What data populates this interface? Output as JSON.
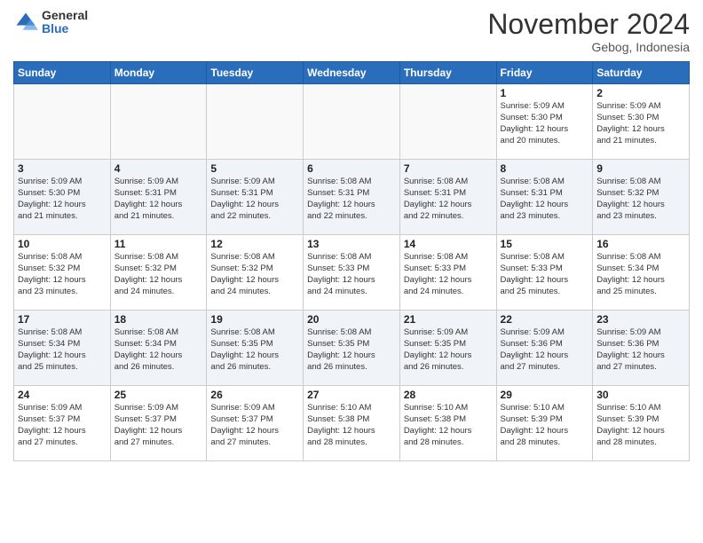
{
  "header": {
    "logo": {
      "general": "General",
      "blue": "Blue"
    },
    "title": "November 2024",
    "location": "Gebog, Indonesia"
  },
  "weekdays": [
    "Sunday",
    "Monday",
    "Tuesday",
    "Wednesday",
    "Thursday",
    "Friday",
    "Saturday"
  ],
  "weeks": [
    [
      {
        "day": "",
        "info": "",
        "empty": true
      },
      {
        "day": "",
        "info": "",
        "empty": true
      },
      {
        "day": "",
        "info": "",
        "empty": true
      },
      {
        "day": "",
        "info": "",
        "empty": true
      },
      {
        "day": "",
        "info": "",
        "empty": true
      },
      {
        "day": "1",
        "info": "Sunrise: 5:09 AM\nSunset: 5:30 PM\nDaylight: 12 hours\nand 20 minutes."
      },
      {
        "day": "2",
        "info": "Sunrise: 5:09 AM\nSunset: 5:30 PM\nDaylight: 12 hours\nand 21 minutes."
      }
    ],
    [
      {
        "day": "3",
        "info": "Sunrise: 5:09 AM\nSunset: 5:30 PM\nDaylight: 12 hours\nand 21 minutes."
      },
      {
        "day": "4",
        "info": "Sunrise: 5:09 AM\nSunset: 5:31 PM\nDaylight: 12 hours\nand 21 minutes."
      },
      {
        "day": "5",
        "info": "Sunrise: 5:09 AM\nSunset: 5:31 PM\nDaylight: 12 hours\nand 22 minutes."
      },
      {
        "day": "6",
        "info": "Sunrise: 5:08 AM\nSunset: 5:31 PM\nDaylight: 12 hours\nand 22 minutes."
      },
      {
        "day": "7",
        "info": "Sunrise: 5:08 AM\nSunset: 5:31 PM\nDaylight: 12 hours\nand 22 minutes."
      },
      {
        "day": "8",
        "info": "Sunrise: 5:08 AM\nSunset: 5:31 PM\nDaylight: 12 hours\nand 23 minutes."
      },
      {
        "day": "9",
        "info": "Sunrise: 5:08 AM\nSunset: 5:32 PM\nDaylight: 12 hours\nand 23 minutes."
      }
    ],
    [
      {
        "day": "10",
        "info": "Sunrise: 5:08 AM\nSunset: 5:32 PM\nDaylight: 12 hours\nand 23 minutes."
      },
      {
        "day": "11",
        "info": "Sunrise: 5:08 AM\nSunset: 5:32 PM\nDaylight: 12 hours\nand 24 minutes."
      },
      {
        "day": "12",
        "info": "Sunrise: 5:08 AM\nSunset: 5:32 PM\nDaylight: 12 hours\nand 24 minutes."
      },
      {
        "day": "13",
        "info": "Sunrise: 5:08 AM\nSunset: 5:33 PM\nDaylight: 12 hours\nand 24 minutes."
      },
      {
        "day": "14",
        "info": "Sunrise: 5:08 AM\nSunset: 5:33 PM\nDaylight: 12 hours\nand 24 minutes."
      },
      {
        "day": "15",
        "info": "Sunrise: 5:08 AM\nSunset: 5:33 PM\nDaylight: 12 hours\nand 25 minutes."
      },
      {
        "day": "16",
        "info": "Sunrise: 5:08 AM\nSunset: 5:34 PM\nDaylight: 12 hours\nand 25 minutes."
      }
    ],
    [
      {
        "day": "17",
        "info": "Sunrise: 5:08 AM\nSunset: 5:34 PM\nDaylight: 12 hours\nand 25 minutes."
      },
      {
        "day": "18",
        "info": "Sunrise: 5:08 AM\nSunset: 5:34 PM\nDaylight: 12 hours\nand 26 minutes."
      },
      {
        "day": "19",
        "info": "Sunrise: 5:08 AM\nSunset: 5:35 PM\nDaylight: 12 hours\nand 26 minutes."
      },
      {
        "day": "20",
        "info": "Sunrise: 5:08 AM\nSunset: 5:35 PM\nDaylight: 12 hours\nand 26 minutes."
      },
      {
        "day": "21",
        "info": "Sunrise: 5:09 AM\nSunset: 5:35 PM\nDaylight: 12 hours\nand 26 minutes."
      },
      {
        "day": "22",
        "info": "Sunrise: 5:09 AM\nSunset: 5:36 PM\nDaylight: 12 hours\nand 27 minutes."
      },
      {
        "day": "23",
        "info": "Sunrise: 5:09 AM\nSunset: 5:36 PM\nDaylight: 12 hours\nand 27 minutes."
      }
    ],
    [
      {
        "day": "24",
        "info": "Sunrise: 5:09 AM\nSunset: 5:37 PM\nDaylight: 12 hours\nand 27 minutes."
      },
      {
        "day": "25",
        "info": "Sunrise: 5:09 AM\nSunset: 5:37 PM\nDaylight: 12 hours\nand 27 minutes."
      },
      {
        "day": "26",
        "info": "Sunrise: 5:09 AM\nSunset: 5:37 PM\nDaylight: 12 hours\nand 27 minutes."
      },
      {
        "day": "27",
        "info": "Sunrise: 5:10 AM\nSunset: 5:38 PM\nDaylight: 12 hours\nand 28 minutes."
      },
      {
        "day": "28",
        "info": "Sunrise: 5:10 AM\nSunset: 5:38 PM\nDaylight: 12 hours\nand 28 minutes."
      },
      {
        "day": "29",
        "info": "Sunrise: 5:10 AM\nSunset: 5:39 PM\nDaylight: 12 hours\nand 28 minutes."
      },
      {
        "day": "30",
        "info": "Sunrise: 5:10 AM\nSunset: 5:39 PM\nDaylight: 12 hours\nand 28 minutes."
      }
    ]
  ]
}
